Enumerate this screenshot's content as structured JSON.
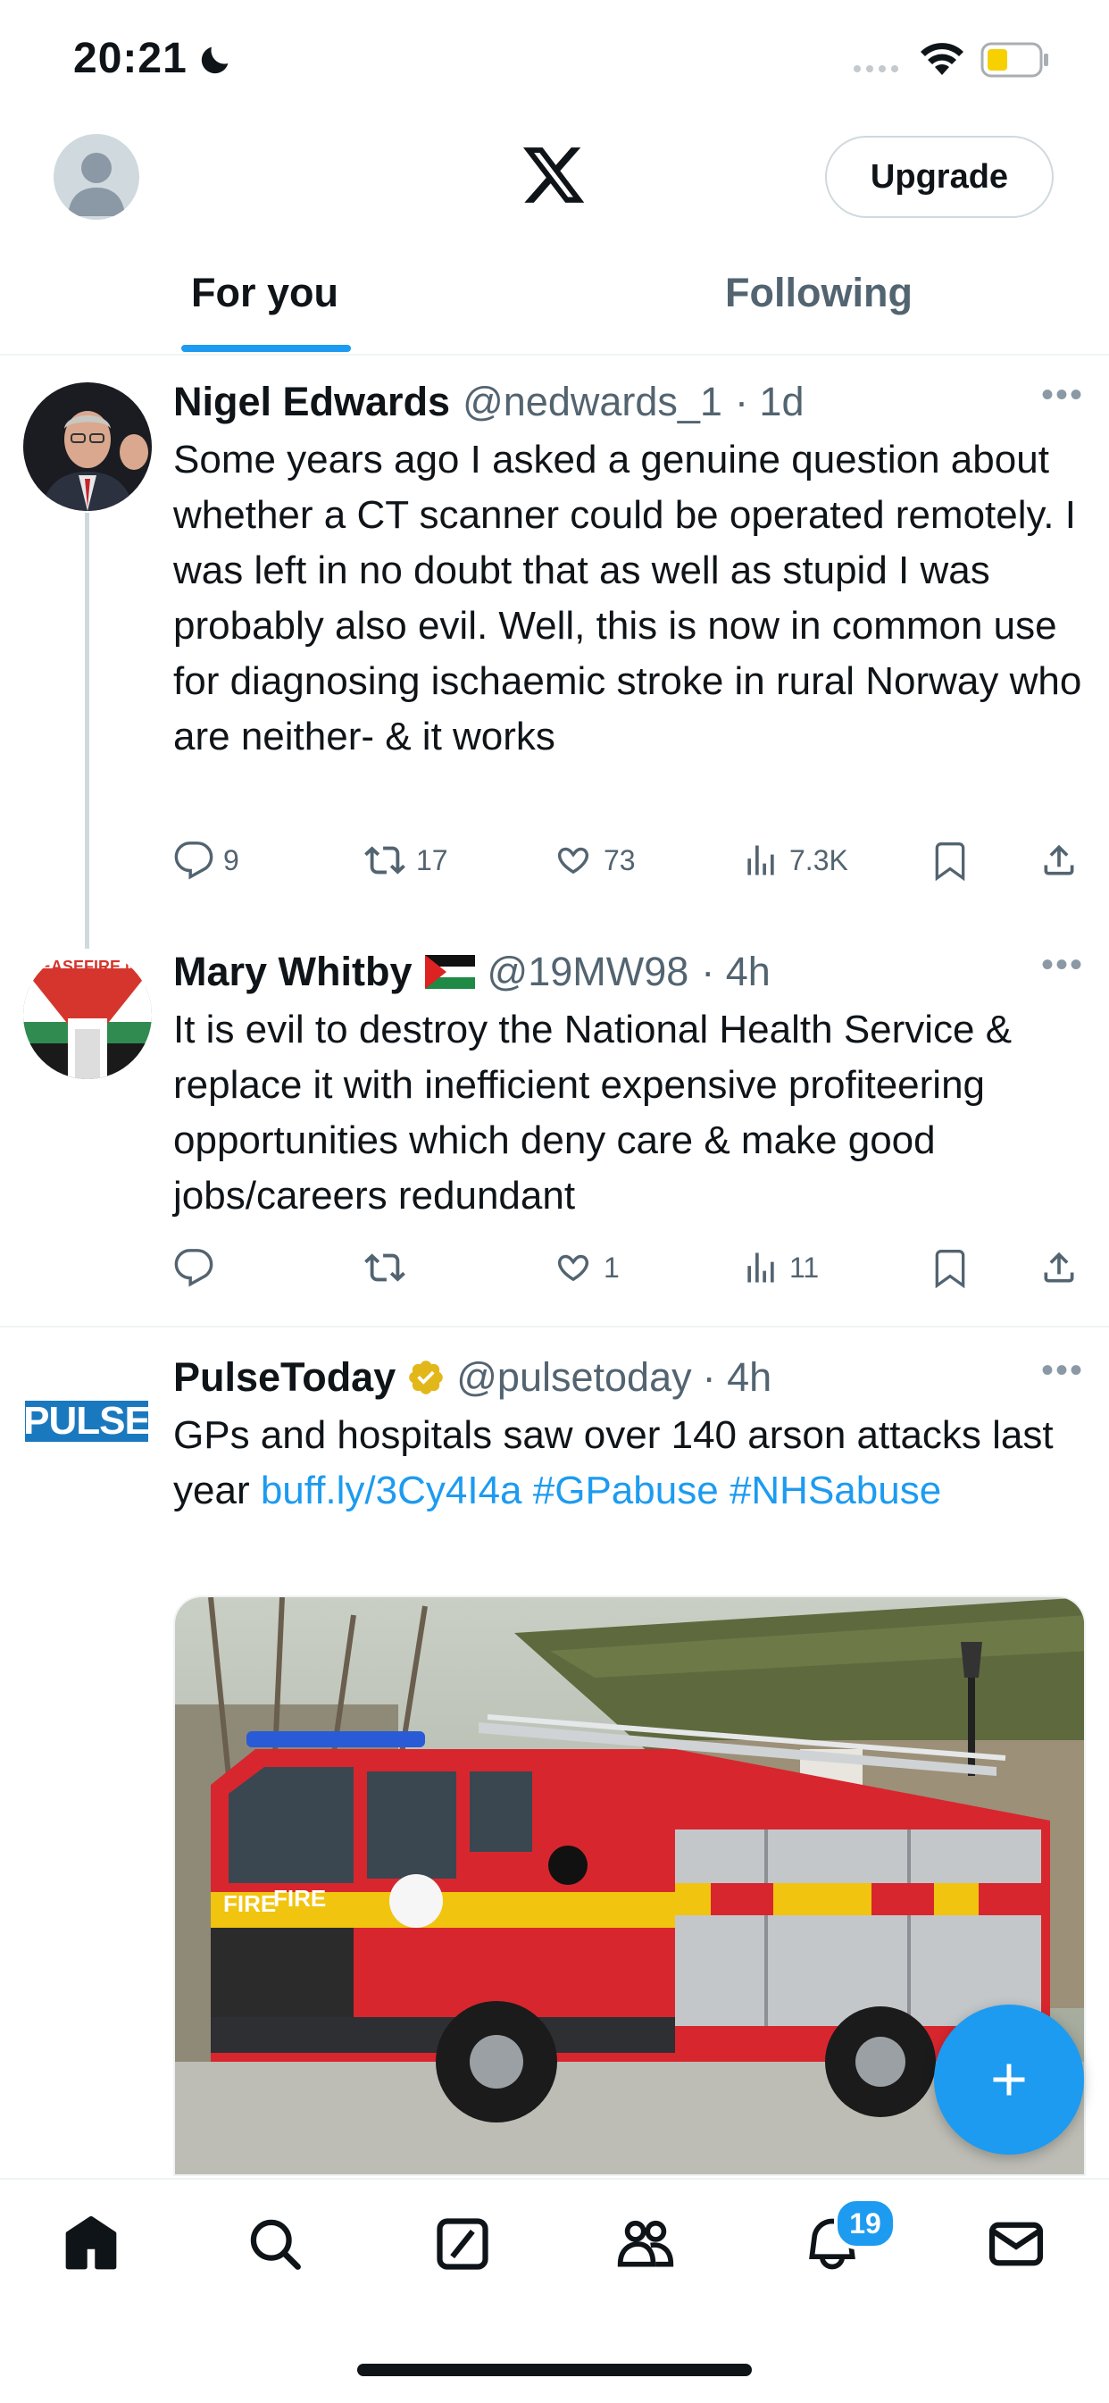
{
  "status_bar": {
    "time": "20:21"
  },
  "header": {
    "upgrade_label": "Upgrade"
  },
  "tabs": [
    {
      "label": "For you",
      "selected": true
    },
    {
      "label": "Following",
      "selected": false
    }
  ],
  "tweets": [
    {
      "name": "Nigel Edwards",
      "handle": "@nedwards_1",
      "time": "· 1d",
      "text": "Some years ago I asked a genuine question about whether a CT scanner could be operated remotely.  I was left in no doubt that as well as stupid I was probably also evil.  Well, this is now in common use  for diagnosing ischaemic stroke in rural Norway who are neither- & it works",
      "replies": "9",
      "retweets": "17",
      "likes": "73",
      "views": "7.3K"
    },
    {
      "name": "Mary Whitby",
      "handle": "@19MW98",
      "time": "· 4h",
      "avatar_text": "CEASEFIRE NO",
      "text": "It is evil to destroy the National Health Service & replace it with inefficient expensive profiteering opportunities which deny care & make good jobs/careers redundant",
      "replies": "",
      "retweets": "",
      "likes": "1",
      "views": "11"
    },
    {
      "name": "PulseToday",
      "handle": "@pulsetoday",
      "time": "· 4h",
      "avatar_text": "PULSE",
      "text_plain": "GPs and hospitals saw over 140 arson attacks last year ",
      "link": "buff.ly/3Cy4I4a",
      "hashtag1": "#GPabuse",
      "hashtag2": "#NHSabuse",
      "media_texts": {
        "fire1": "FIRE",
        "fire2": "FIRE"
      }
    }
  ],
  "notifications_badge": "19",
  "colors": {
    "accent": "#1d9bf0",
    "text": "#0f1419",
    "secondary": "#536471",
    "verified": "#e2b719"
  },
  "icons": [
    "moon-icon",
    "signal-icon",
    "wifi-icon",
    "battery-icon",
    "x-logo-icon",
    "reply-icon",
    "retweet-icon",
    "like-icon",
    "views-icon",
    "bookmark-icon",
    "share-icon",
    "more-icon",
    "verified-icon",
    "flag-icon",
    "compose-icon",
    "home-icon",
    "search-icon",
    "grok-icon",
    "communities-icon",
    "bell-icon",
    "mail-icon"
  ]
}
